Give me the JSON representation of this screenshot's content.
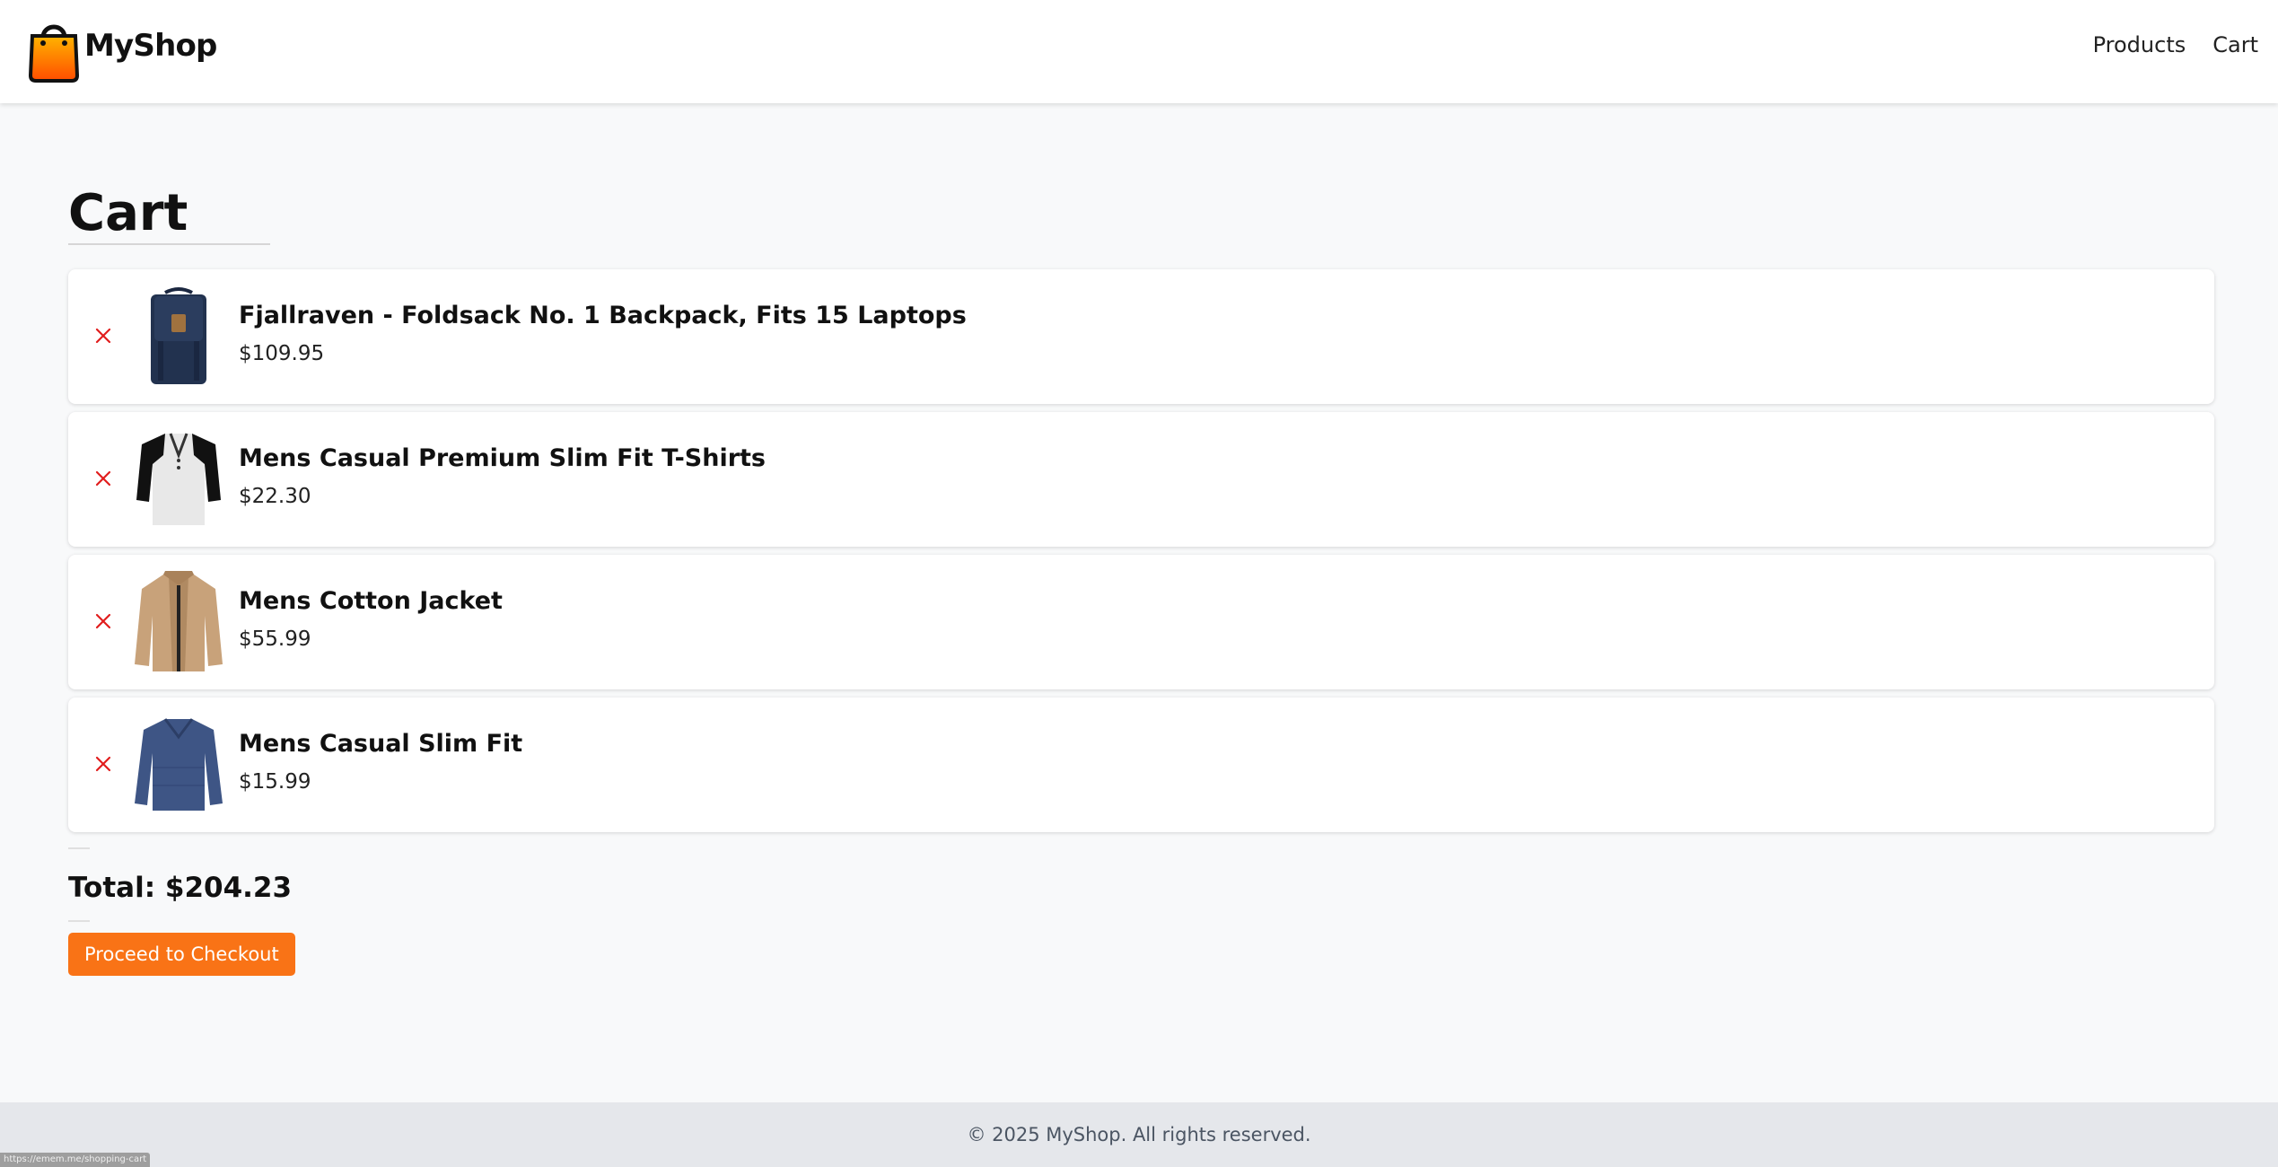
{
  "header": {
    "brand": "MyShop",
    "nav": [
      {
        "label": "Products"
      },
      {
        "label": "Cart"
      }
    ]
  },
  "cart": {
    "title": "Cart",
    "items": [
      {
        "name": "Fjallraven - Foldsack No. 1 Backpack, Fits 15 Laptops",
        "price": "$109.95",
        "image": "backpack-image"
      },
      {
        "name": "Mens Casual Premium Slim Fit T-Shirts",
        "price": "$22.30",
        "image": "tshirt-image"
      },
      {
        "name": "Mens Cotton Jacket",
        "price": "$55.99",
        "image": "jacket-image"
      },
      {
        "name": "Mens Casual Slim Fit",
        "price": "$15.99",
        "image": "longsleeve-image"
      }
    ],
    "remove_icon": "close-icon",
    "total": "Total: $204.23",
    "checkout_label": "Proceed to Checkout"
  },
  "footer": {
    "text": "© 2025 MyShop. All rights reserved."
  },
  "status_bar": {
    "url": "https://emem.me/shopping-cart"
  },
  "colors": {
    "accent": "#f97316",
    "remove": "#e11d1d",
    "footer_bg": "#e5e7eb",
    "page_bg": "#f8f9fa"
  }
}
